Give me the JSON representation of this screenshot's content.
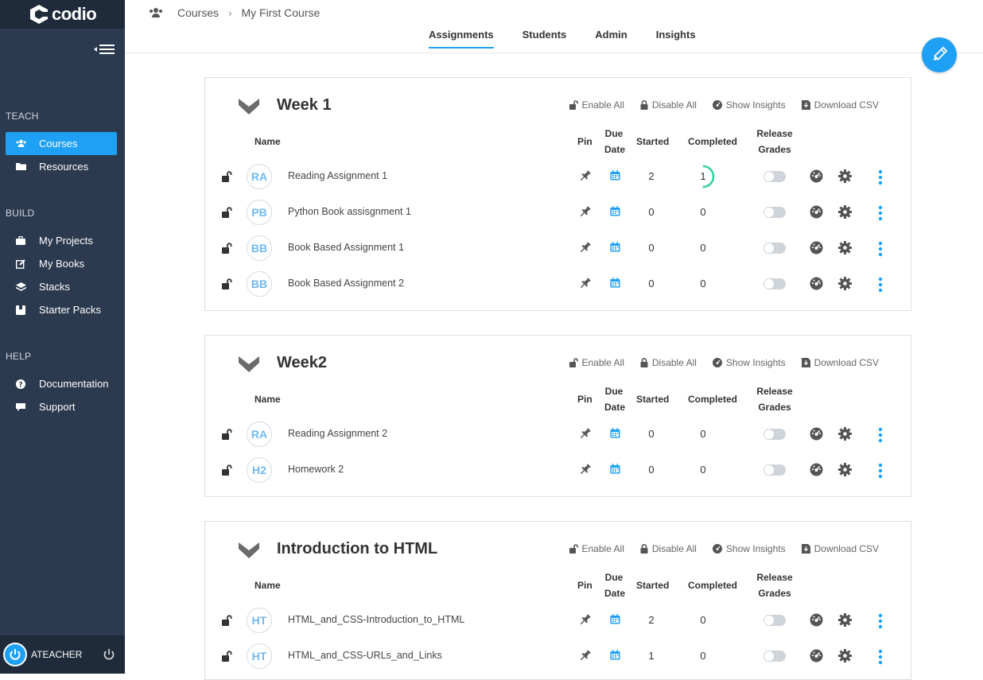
{
  "app": {
    "logo_text": "codio"
  },
  "sidebar": {
    "sections": [
      {
        "title": "TEACH",
        "items": [
          {
            "label": "Courses",
            "icon": "users-icon",
            "active": true
          },
          {
            "label": "Resources",
            "icon": "folder-icon"
          }
        ]
      },
      {
        "title": "BUILD",
        "items": [
          {
            "label": "My Projects",
            "icon": "briefcase-icon"
          },
          {
            "label": "My Books",
            "icon": "edit-icon"
          },
          {
            "label": "Stacks",
            "icon": "layers-icon"
          },
          {
            "label": "Starter Packs",
            "icon": "package-icon"
          }
        ]
      },
      {
        "title": "HELP",
        "items": [
          {
            "label": "Documentation",
            "icon": "question-icon"
          },
          {
            "label": "Support",
            "icon": "chat-icon"
          }
        ]
      }
    ],
    "user": {
      "name": "ATEACHER"
    }
  },
  "breadcrumb": {
    "root": "Courses",
    "current": "My First Course"
  },
  "tabs": [
    {
      "label": "Assignments",
      "active": true
    },
    {
      "label": "Students"
    },
    {
      "label": "Admin"
    },
    {
      "label": "Insights"
    }
  ],
  "actions": {
    "enable_all": "Enable All",
    "disable_all": "Disable All",
    "show_insights": "Show Insights",
    "download_csv": "Download CSV"
  },
  "columns": {
    "name": "Name",
    "pin": "Pin",
    "due_line1": "Due",
    "due_line2": "Date",
    "started": "Started",
    "completed": "Completed",
    "release_line1": "Release",
    "release_line2": "Grades"
  },
  "colors": {
    "accent": "#1ea0f5",
    "sidebar": "#2b3a4f",
    "progress": "#2bd0a0"
  },
  "modules": [
    {
      "title": "Week 1",
      "assignments": [
        {
          "initials": "RA",
          "name": "Reading Assignment 1",
          "started": "2",
          "completed": "1",
          "progress": 0.5
        },
        {
          "initials": "PB",
          "name": "Python Book assisgnment 1",
          "started": "0",
          "completed": "0"
        },
        {
          "initials": "BB",
          "name": "Book Based Assignment 1",
          "started": "0",
          "completed": "0"
        },
        {
          "initials": "BB",
          "name": "Book Based Assignment 2",
          "started": "0",
          "completed": "0"
        }
      ]
    },
    {
      "title": "Week2",
      "assignments": [
        {
          "initials": "RA",
          "name": "Reading Assignment 2",
          "started": "0",
          "completed": "0"
        },
        {
          "initials": "H2",
          "name": "Homework 2",
          "started": "0",
          "completed": "0"
        }
      ]
    },
    {
      "title": "Introduction to HTML",
      "assignments": [
        {
          "initials": "HT",
          "name": "HTML_and_CSS-Introduction_to_HTML",
          "started": "2",
          "completed": "0"
        },
        {
          "initials": "HT",
          "name": "HTML_and_CSS-URLs_and_Links",
          "started": "1",
          "completed": "0"
        }
      ]
    }
  ]
}
